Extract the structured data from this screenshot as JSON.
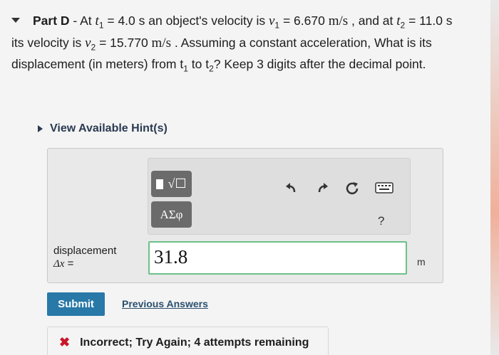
{
  "part": {
    "label": "Part D",
    "q_intro": " - At ",
    "t1_sym": "t",
    "t1_sub": "1",
    "q_t1_val": " = 4.0 s an object's velocity is ",
    "v1_sym": "v",
    "v1_sub": "1",
    "q_v1_val": " = 6.670 ",
    "unit_ms": "m/s",
    "q_mid": " , and at ",
    "t2_sym": "t",
    "t2_sub": "2",
    "q_t2_eq": " = 11.0 s its velocity is ",
    "v2_sym": "v",
    "v2_sub": "2",
    "q_v2_val": " = 15.770 ",
    "q_tail1": " . Assuming a constant acceleration, What is its displacement (in meters) from t",
    "q_tail_sub1": "1",
    "q_tail2": " to t",
    "q_tail_sub2": "2",
    "q_tail3": "? Keep 3 digits after the decimal point."
  },
  "hints_label": "View Available Hint(s)",
  "toolbar": {
    "templates_icon": "templates-icon",
    "greek_label": "ΑΣφ",
    "help_label": "?",
    "undo_icon": "undo-icon",
    "redo_icon": "redo-icon",
    "reset_icon": "reset-icon",
    "keyboard_icon": "keyboard-icon"
  },
  "answer": {
    "label_line1": "displacement",
    "label_line2_sym": "Δx",
    "label_line2_eq": " =",
    "value": "31.8",
    "unit": "m"
  },
  "submit_label": "Submit",
  "previous_answers_label": "Previous Answers",
  "feedback": {
    "icon": "x-icon",
    "text": "Incorrect; Try Again; 4 attempts remaining"
  },
  "colors": {
    "accent": "#2878a8",
    "input_border": "#6cc08a",
    "error": "#c8182a"
  }
}
